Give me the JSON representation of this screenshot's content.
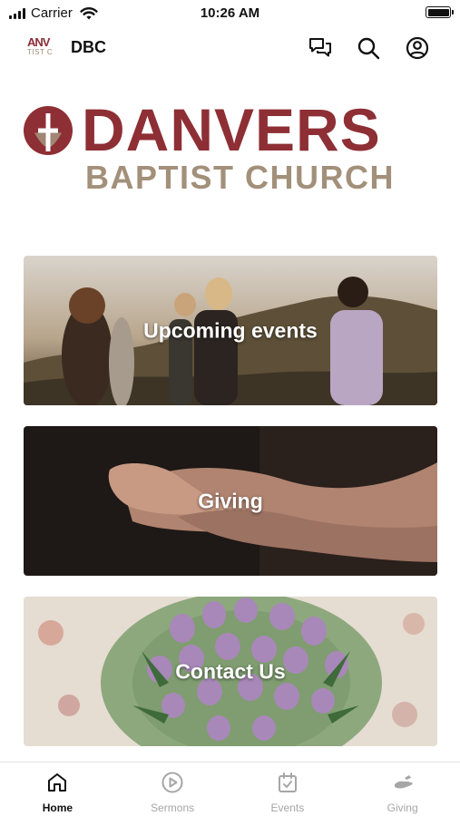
{
  "status_bar": {
    "carrier": "Carrier",
    "time": "10:26 AM"
  },
  "header": {
    "app_title": "DBC",
    "mini_logo": {
      "top": "ANV",
      "bottom": "TIST C"
    },
    "icons": [
      "chat-icon",
      "search-icon",
      "account-icon"
    ]
  },
  "logo": {
    "line1": "DANVERS",
    "line2": "BAPTIST CHURCH"
  },
  "cards": [
    {
      "title": "Upcoming events"
    },
    {
      "title": "Giving"
    },
    {
      "title": "Contact Us"
    }
  ],
  "tabs": [
    {
      "label": "Home",
      "icon": "home-icon",
      "active": true
    },
    {
      "label": "Sermons",
      "icon": "play-circle-icon",
      "active": false
    },
    {
      "label": "Events",
      "icon": "calendar-check-icon",
      "active": false
    },
    {
      "label": "Giving",
      "icon": "giving-hands-icon",
      "active": false
    }
  ],
  "colors": {
    "brand_red": "#8d2f34",
    "brand_tan": "#a3907a",
    "tab_inactive": "#a6a6a6",
    "tab_active": "#111111"
  }
}
